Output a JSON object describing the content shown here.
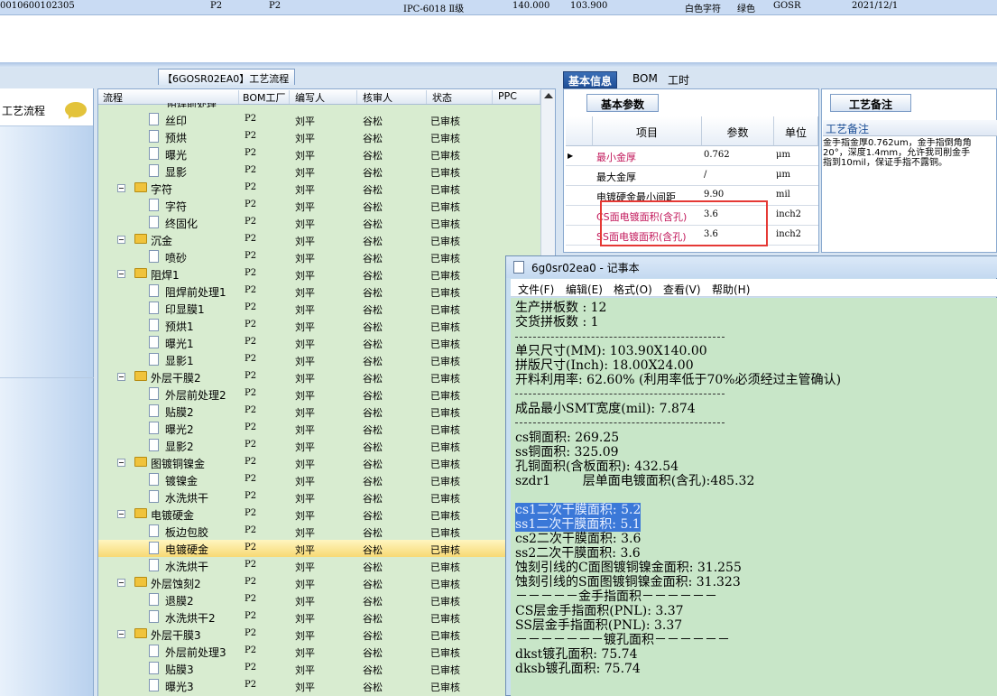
{
  "top_row": {
    "order_no": "0010600102305",
    "p1": "P2",
    "p2": "P2",
    "grade": "IPC-6018 Ⅱ级",
    "len": "140.000",
    "wid": "103.900",
    "char_color": "白色字符",
    "mask_color": "绿色",
    "code": "GOSR",
    "date": "2021/12/1"
  },
  "sidebar": {
    "title": "工艺流程"
  },
  "flow": {
    "tab_prefix": "【6GOSR02EA0】",
    "tab_title": "工艺流程",
    "headers": [
      "流程",
      "BOM工厂",
      "编写人",
      "核审人",
      "状态",
      "PPC"
    ],
    "top_partial": "阻焊前处理",
    "rows": [
      {
        "name": "丝印",
        "level": 2,
        "type": "doc"
      },
      {
        "name": "预烘",
        "level": 2,
        "type": "doc"
      },
      {
        "name": "曝光",
        "level": 2,
        "type": "doc"
      },
      {
        "name": "显影",
        "level": 2,
        "type": "doc"
      },
      {
        "name": "字符",
        "level": 1,
        "type": "folder"
      },
      {
        "name": "字符",
        "level": 2,
        "type": "doc"
      },
      {
        "name": "终固化",
        "level": 2,
        "type": "doc"
      },
      {
        "name": "沉金",
        "level": 1,
        "type": "folder"
      },
      {
        "name": "喷砂",
        "level": 2,
        "type": "doc"
      },
      {
        "name": "阻焊1",
        "level": 1,
        "type": "folder"
      },
      {
        "name": "阻焊前处理1",
        "level": 2,
        "type": "doc"
      },
      {
        "name": "印显膜1",
        "level": 2,
        "type": "doc"
      },
      {
        "name": "预烘1",
        "level": 2,
        "type": "doc"
      },
      {
        "name": "曝光1",
        "level": 2,
        "type": "doc"
      },
      {
        "name": "显影1",
        "level": 2,
        "type": "doc"
      },
      {
        "name": "外层干膜2",
        "level": 1,
        "type": "folder"
      },
      {
        "name": "外层前处理2",
        "level": 2,
        "type": "doc"
      },
      {
        "name": "贴膜2",
        "level": 2,
        "type": "doc"
      },
      {
        "name": "曝光2",
        "level": 2,
        "type": "doc"
      },
      {
        "name": "显影2",
        "level": 2,
        "type": "doc"
      },
      {
        "name": "图镀铜镍金",
        "level": 1,
        "type": "folder"
      },
      {
        "name": "镀镍金",
        "level": 2,
        "type": "doc"
      },
      {
        "name": "水洗烘干",
        "level": 2,
        "type": "doc"
      },
      {
        "name": "电镀硬金",
        "level": 1,
        "type": "folder"
      },
      {
        "name": "板边包胶",
        "level": 2,
        "type": "doc"
      },
      {
        "name": "电镀硬金",
        "level": 2,
        "type": "doc",
        "selected": true
      },
      {
        "name": "水洗烘干",
        "level": 2,
        "type": "doc"
      },
      {
        "name": "外层蚀刻2",
        "level": 1,
        "type": "folder"
      },
      {
        "name": "退膜2",
        "level": 2,
        "type": "doc"
      },
      {
        "name": "水洗烘干2",
        "level": 2,
        "type": "doc"
      },
      {
        "name": "外层干膜3",
        "level": 1,
        "type": "folder"
      },
      {
        "name": "外层前处理3",
        "level": 2,
        "type": "doc"
      },
      {
        "name": "贴膜3",
        "level": 2,
        "type": "doc"
      },
      {
        "name": "曝光3",
        "level": 2,
        "type": "doc"
      }
    ],
    "bom": "P2",
    "writer": "刘平",
    "reviewer": "谷松",
    "status": "已审核"
  },
  "right_tabs": [
    "基本信息",
    "BOM",
    "工时"
  ],
  "basic": {
    "subtab": "基本参数",
    "headers": [
      "项目",
      "参数",
      "单位"
    ],
    "rows": [
      {
        "item": "最小金厚",
        "value": "0.762",
        "unit": "μm",
        "red": true
      },
      {
        "item": "最大金厚",
        "value": "/",
        "unit": "μm",
        "red": false
      },
      {
        "item": "电镀硬金最小间距",
        "value": "9.90",
        "unit": "mil",
        "red": false
      },
      {
        "item": "CS面电镀面积(含孔)",
        "value": "3.6",
        "unit": "inch2",
        "red": true
      },
      {
        "item": "SS面电镀面积(含孔)",
        "value": "3.6",
        "unit": "inch2",
        "red": true
      }
    ]
  },
  "remark": {
    "tab": "工艺备注",
    "head": "工艺备注",
    "text": "金手指金厚0.762um，金手指倒角角\n20°，深度1.4mm，允许我司削金手\n指到10mil，保证手指不露铜。"
  },
  "notepad": {
    "title": "6g0sr02ea0 - 记事本",
    "menu": [
      "文件(F)",
      "编辑(E)",
      "格式(O)",
      "查看(V)",
      "帮助(H)"
    ],
    "lines": {
      "l1": "生产拼板数 : 12",
      "l2": "交货拼板数 : 1",
      "l3": "单只尺寸(MM): 103.90X140.00",
      "l4": "拼版尺寸(Inch): 18.00X24.00",
      "l5": "开料利用率: 62.60% (利用率低于70%必须经过主管确认)",
      "l6": "成品最小SMT宽度(mil): 7.874",
      "l7": "cs铜面积: 269.25",
      "l8": "ss铜面积: 325.09",
      "l9": "孔铜面积(含板面积): 432.54",
      "l10": "szdr1        层单面电镀面积(含孔):485.32",
      "l11": "cs1二次干膜面积: 5.2",
      "l12": "ss1二次干膜面积: 5.1",
      "l13": "cs2二次干膜面积: 3.6",
      "l14": "ss2二次干膜面积: 3.6",
      "l15": "蚀刻引线的C面图镀铜镍金面积: 31.255",
      "l16": "蚀刻引线的S面图镀铜镍金面积: 31.323",
      "l17": "－－－－－金手指面积－－－－－－",
      "l18": "CS层金手指面积(PNL): 3.37",
      "l19": "SS层金手指面积(PNL): 3.37",
      "l20": "－－－－－－－镀孔面积－－－－－－",
      "l21": "dkst镀孔面积: 75.74",
      "l22": "dksb镀孔面积: 75.74"
    }
  }
}
